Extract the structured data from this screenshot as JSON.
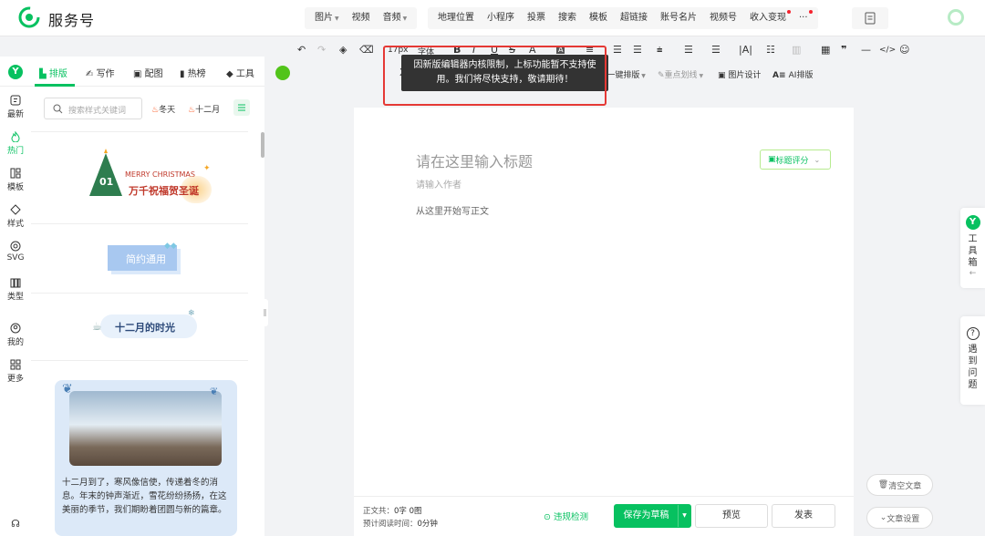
{
  "header": {
    "brand": "服务号",
    "nav_group_1": [
      "图片",
      "视频",
      "音频"
    ],
    "nav_group_2": [
      "地理位置",
      "小程序",
      "投票",
      "搜索",
      "模板",
      "超链接",
      "账号名片",
      "视频号",
      "收入变现",
      "···"
    ]
  },
  "left_nav": [
    {
      "label": "最新",
      "icon": "clock-icon"
    },
    {
      "label": "热门",
      "icon": "flame-icon",
      "active": true
    },
    {
      "label": "模板",
      "icon": "template-icon"
    },
    {
      "label": "样式",
      "icon": "style-icon"
    },
    {
      "label": "SVG",
      "icon": "svg-icon"
    },
    {
      "label": "类型",
      "icon": "type-icon"
    },
    {
      "label": "我的",
      "icon": "user-icon"
    },
    {
      "label": "更多",
      "icon": "grid-icon"
    }
  ],
  "panel_tabs": [
    "排版",
    "写作",
    "配图",
    "热榜",
    "工具"
  ],
  "panel": {
    "search_placeholder": "搜索样式关键词",
    "hot_tags": [
      "冬天",
      "十二月"
    ],
    "card1": {
      "text1": "MERRY CHRISTMAS",
      "text2": "万千祝福贺圣诞",
      "num": "01"
    },
    "card2": {
      "text": "简约通用"
    },
    "card3": {
      "text": "十二月的时光"
    },
    "card4": {
      "text": "十二月到了，寒风像信使，传递着冬的消息。年末的钟声渐近，雪花纷纷扬扬，在这美丽的季节，我们期盼着团圆与新的篇章。"
    }
  },
  "toolbar": {
    "font_size": "17px",
    "font": "字体",
    "row2": {
      "one_click": "一键排版",
      "highlight": "重点划线",
      "image_design": "图片设计",
      "ai": "AI排版"
    }
  },
  "tooltip": "因新版编辑器内核限制，上标功能暂不支持使用。我们将尽快支持，敬请期待！",
  "editor": {
    "title_placeholder": "请在这里输入标题",
    "title_score": "标题评分",
    "author_placeholder": "请输入作者",
    "body_placeholder": "从这里开始写正文"
  },
  "footer": {
    "word_count_label": "正文共：",
    "word_count": "0字 0图",
    "read_time_label": "预计阅读时间：",
    "read_time": "0分钟",
    "check": "违规检测",
    "save_draft": "保存为草稿",
    "preview": "预览",
    "publish": "发表"
  },
  "side": {
    "toolbox": "工具箱",
    "problem": "遇到问题",
    "clear": "清空文章",
    "settings": "文章设置"
  },
  "colors": {
    "accent": "#07c160",
    "danger": "#e53935"
  }
}
